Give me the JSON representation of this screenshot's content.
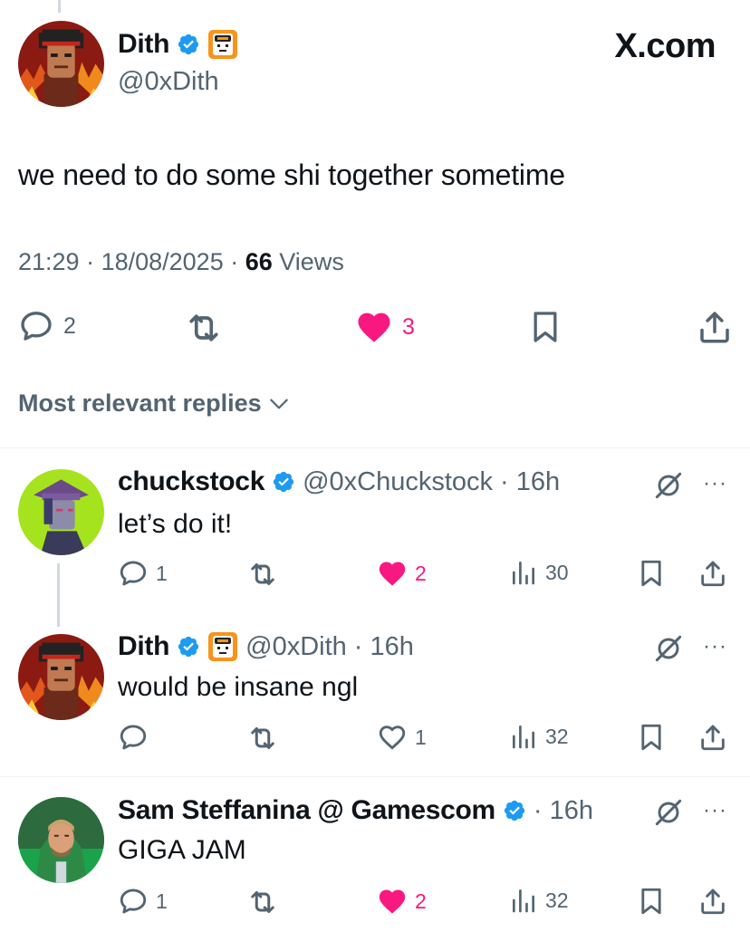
{
  "post": {
    "author_name": "Dith",
    "author_handle": "@0xDith",
    "brand": "X.com",
    "text": "we need to do some shi together sometime",
    "time": "21:29",
    "date": "18/08/2025",
    "views_count": "66",
    "views_label": "Views",
    "replies": "2",
    "likes": "3",
    "liked": true
  },
  "sort_label": "Most relevant replies",
  "replies": [
    {
      "name": "chuckstock",
      "handle": "@0xChuckstock",
      "time": "16h",
      "text": "let’s do it!",
      "reply_count": "1",
      "like_count": "2",
      "liked": true,
      "view_count": "30"
    },
    {
      "name": "Dith",
      "handle": "@0xDith",
      "time": "16h",
      "text": "would be insane ngl",
      "reply_count": "",
      "like_count": "1",
      "liked": false,
      "view_count": "32"
    },
    {
      "name": "Sam Steffanina @ Gamescom",
      "handle": "",
      "time": "16h",
      "text": "GIGA JAM",
      "reply_count": "1",
      "like_count": "2",
      "liked": true,
      "view_count": "32"
    }
  ],
  "icons": {
    "verified": "verified-badge-icon",
    "affiliate": "giga-affiliate-badge-icon",
    "reply": "reply-bubble-icon",
    "repost": "repost-icon",
    "like": "heart-icon",
    "bookmark": "bookmark-icon",
    "share": "share-icon",
    "views": "views-chart-icon",
    "grok": "grok-icon",
    "more": "more-dots-icon"
  },
  "colors": {
    "verified_blue": "#1d9bf0",
    "like_pink": "#f91880",
    "muted_gray": "#536471",
    "text": "#0f1419"
  }
}
